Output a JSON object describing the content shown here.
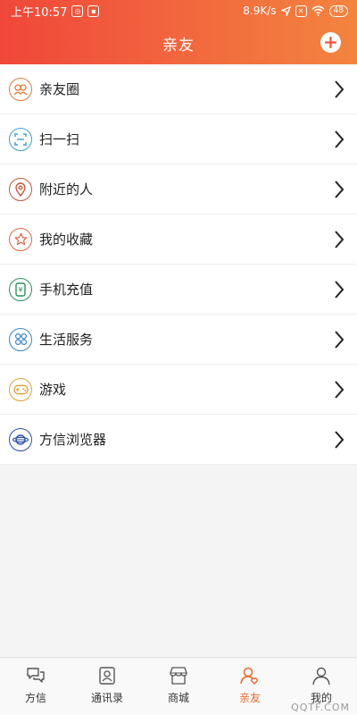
{
  "status_bar": {
    "time": "上午10:57",
    "net_speed": "8.9K/s",
    "battery": "48"
  },
  "header": {
    "title": "亲友"
  },
  "menu_items": [
    {
      "label": "亲友圈",
      "icon": "friends-circle-icon",
      "color": "#e07a3c"
    },
    {
      "label": "扫一扫",
      "icon": "scan-icon",
      "color": "#3b9fd6"
    },
    {
      "label": "附近的人",
      "icon": "location-pin-icon",
      "color": "#c2573f"
    },
    {
      "label": "我的收藏",
      "icon": "star-icon",
      "color": "#e2664a"
    },
    {
      "label": "手机充值",
      "icon": "recharge-icon",
      "color": "#2f8f5a"
    },
    {
      "label": "生活服务",
      "icon": "services-icon",
      "color": "#3b88c4"
    },
    {
      "label": "游戏",
      "icon": "gamepad-icon",
      "color": "#e2a13a"
    },
    {
      "label": "方信浏览器",
      "icon": "globe-icon",
      "color": "#2f4fa8"
    }
  ],
  "tabbar": {
    "tabs": [
      {
        "label": "方信",
        "icon": "chat-icon"
      },
      {
        "label": "通讯录",
        "icon": "contacts-icon"
      },
      {
        "label": "商城",
        "icon": "store-icon"
      },
      {
        "label": "亲友",
        "icon": "friends-icon",
        "active": true
      },
      {
        "label": "我的",
        "icon": "profile-icon"
      }
    ],
    "active_color": "#e8672e"
  },
  "watermark": "QQTF.COM"
}
